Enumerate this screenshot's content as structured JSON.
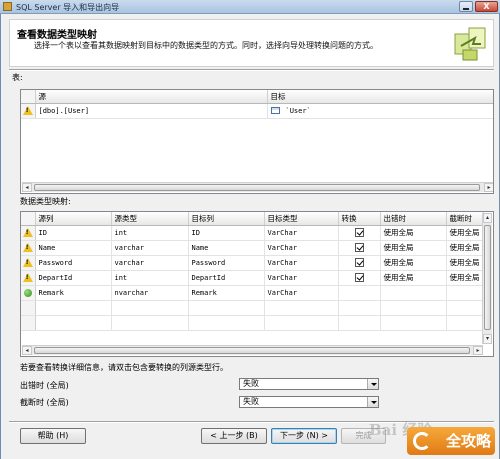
{
  "window": {
    "title": "SQL Server 导入和导出向导",
    "close_glyph": "X"
  },
  "header": {
    "title": "查看数据类型映射",
    "description": "选择一个表以查看其数据映射到目标中的数据类型的方式。同时，选择向导处理转换问题的方式。"
  },
  "tables_section": {
    "label": "表:",
    "columns": [
      "源",
      "目标"
    ],
    "rows": [
      {
        "status": "warning-icon",
        "source": "[dbo].[User]",
        "target": "`User`"
      }
    ]
  },
  "mapping_section": {
    "label": "数据类型映射:",
    "columns": [
      "源列",
      "源类型",
      "目标列",
      "目标类型",
      "转换",
      "出错时",
      "截断时"
    ],
    "rows": [
      {
        "status": "warning-icon",
        "source_col": "ID",
        "source_type": "int",
        "target_col": "ID",
        "target_type": "VarChar",
        "convert": true,
        "on_error": "使用全局",
        "on_truncate": "使用全局"
      },
      {
        "status": "warning-icon",
        "source_col": "Name",
        "source_type": "varchar",
        "target_col": "Name",
        "target_type": "VarChar",
        "convert": true,
        "on_error": "使用全局",
        "on_truncate": "使用全局"
      },
      {
        "status": "warning-icon",
        "source_col": "Password",
        "source_type": "varchar",
        "target_col": "Password",
        "target_type": "VarChar",
        "convert": true,
        "on_error": "使用全局",
        "on_truncate": "使用全局"
      },
      {
        "status": "warning-icon",
        "source_col": "DepartId",
        "source_type": "int",
        "target_col": "DepartId",
        "target_type": "VarChar",
        "convert": true,
        "on_error": "使用全局",
        "on_truncate": "使用全局"
      },
      {
        "status": "ok-icon",
        "source_col": "Remark",
        "source_type": "nvarchar",
        "target_col": "Remark",
        "target_type": "VarChar",
        "convert": false,
        "on_error": "",
        "on_truncate": ""
      }
    ]
  },
  "hint": "若要查看转换详细信息，请双击包含要转换的列源类型行。",
  "global_settings": {
    "on_error_label": "出错时 (全局)",
    "on_error_value": "失败",
    "on_truncate_label": "截断时 (全局)",
    "on_truncate_value": "失败"
  },
  "footer": {
    "help": "帮助 (H)",
    "back": "< 上一步 (B)",
    "next": "下一步 (N) >",
    "finish": "完成",
    "watermark": "Bai 经验",
    "badge": "全攻略"
  }
}
